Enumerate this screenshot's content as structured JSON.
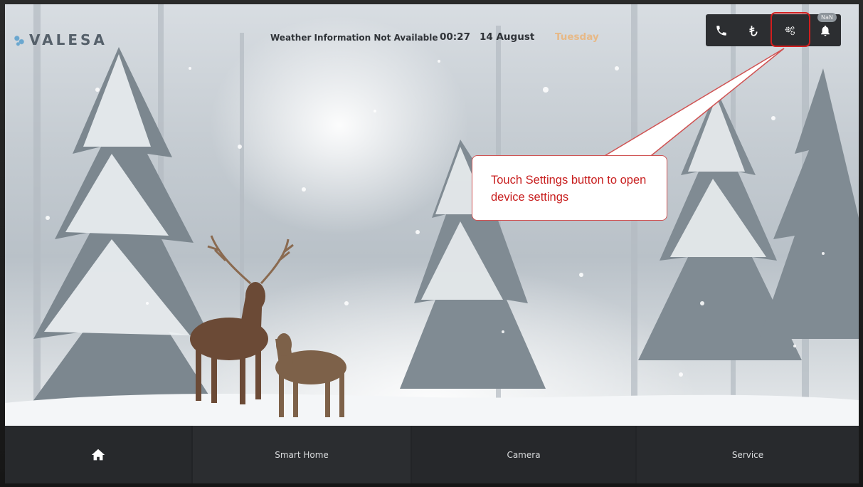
{
  "brand": {
    "logo_text": "VALESA"
  },
  "header": {
    "weather": "Weather Information Not Available",
    "time": "00:27",
    "date": "14 August",
    "weekday": "Tuesday"
  },
  "toolbar": {
    "icons": [
      "phone-icon",
      "currency-icon",
      "settings-icon",
      "bell-icon"
    ],
    "notification_badge": "NaN"
  },
  "annotation": {
    "callout_text": "Touch Settings button to open device settings",
    "highlight_color": "#d21e1e",
    "callout_text_color": "#c81f1f"
  },
  "nav": {
    "home_icon": "home-icon",
    "smart_home": "Smart Home",
    "camera": "Camera",
    "service": "Service"
  },
  "colors": {
    "toolbar_bg": "#2c2e31",
    "nav_bg": "#222427",
    "weekday_accent": "#e7b987"
  }
}
